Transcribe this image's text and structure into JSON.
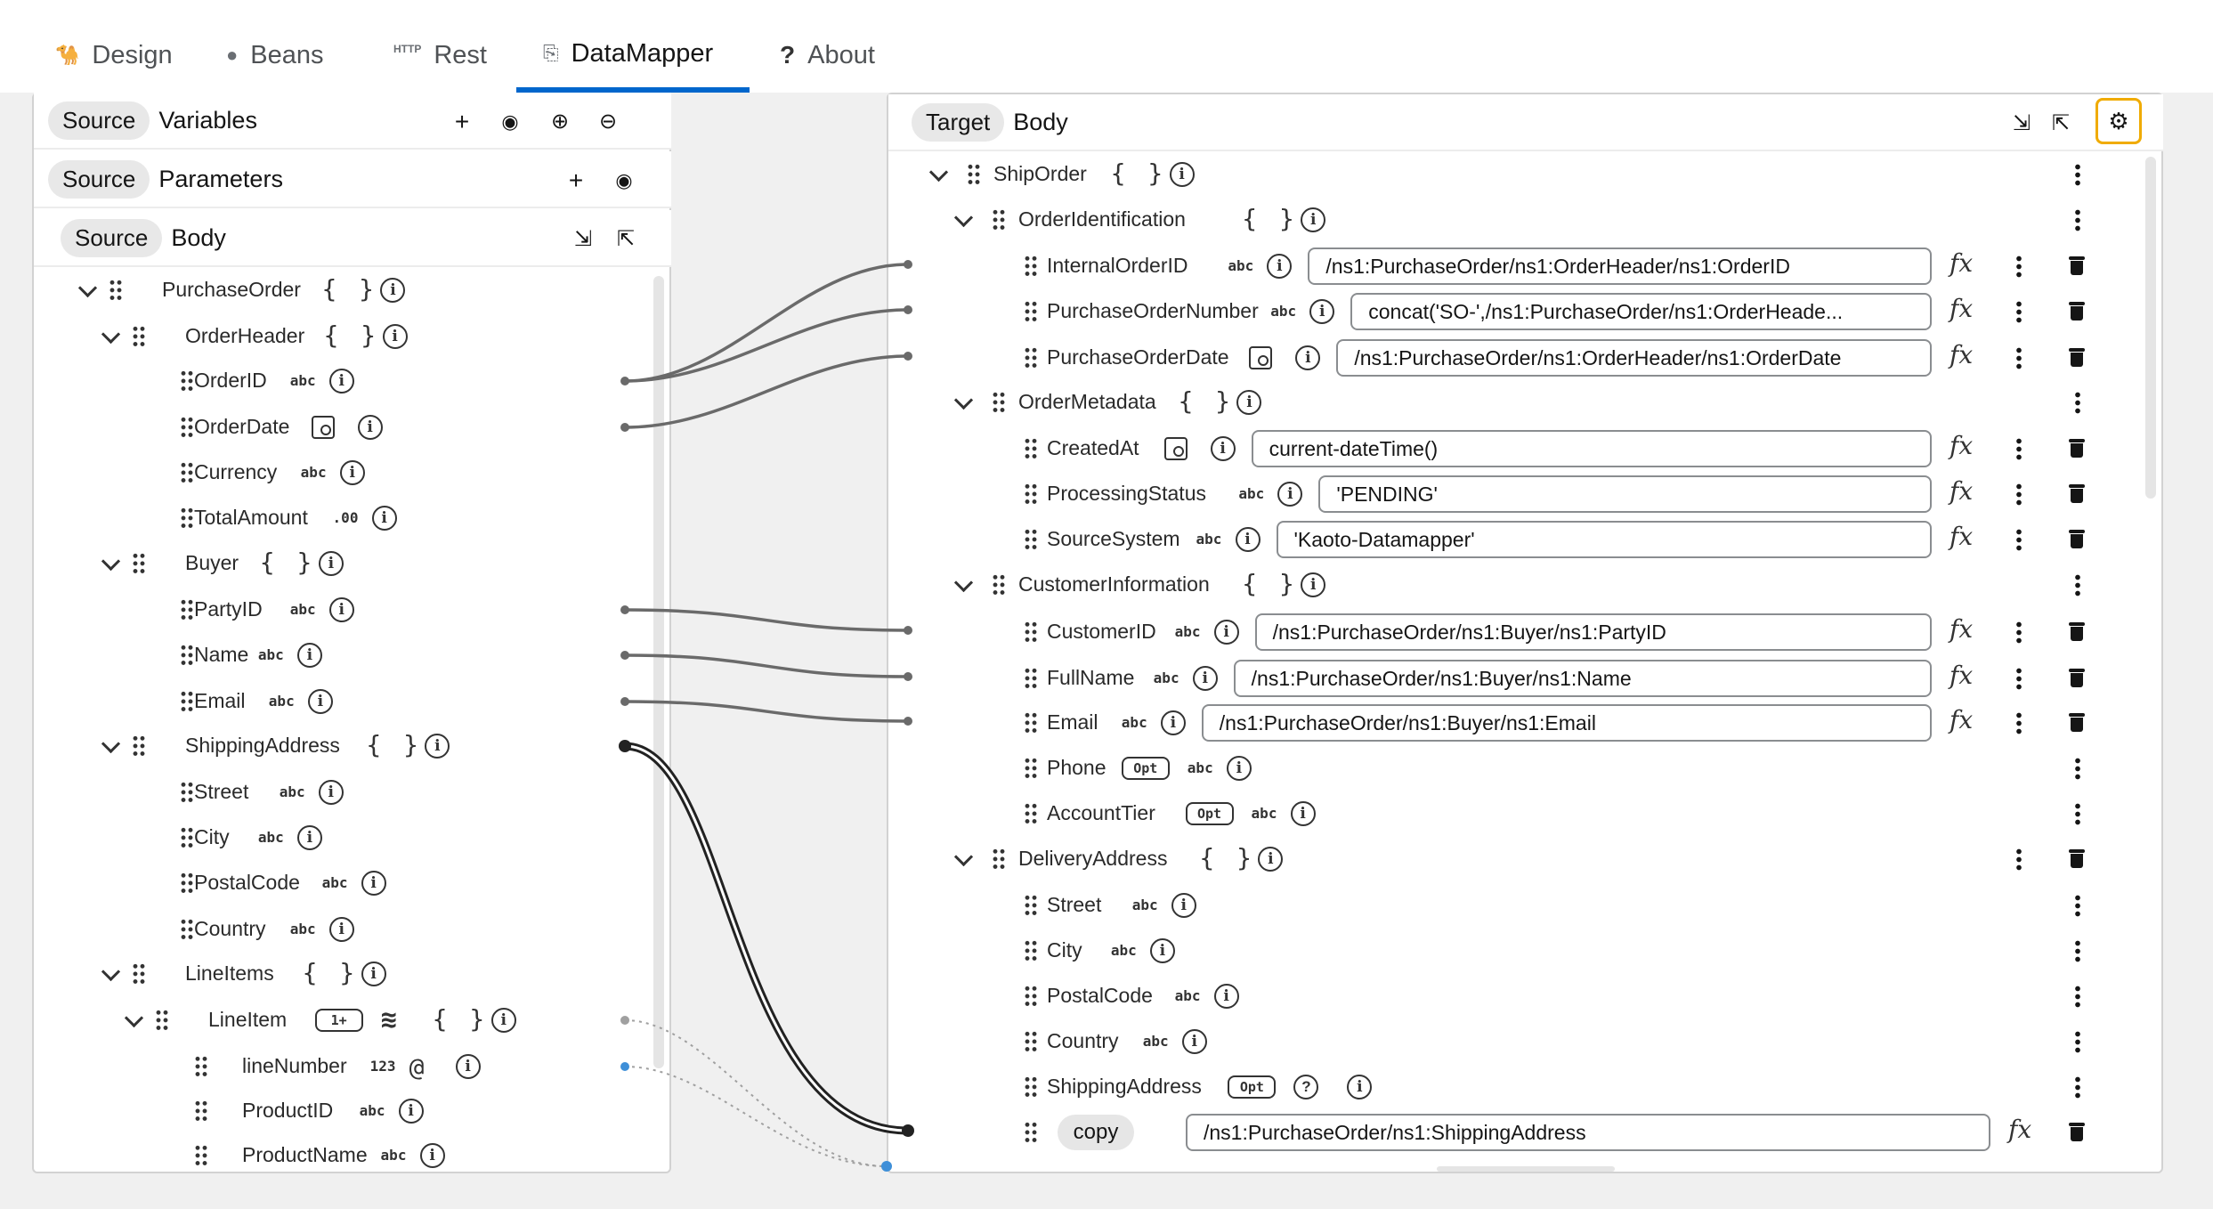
{
  "tabs": [
    {
      "label": "Design",
      "icon": "camel-icon"
    },
    {
      "label": "Beans",
      "icon": "bean-icon"
    },
    {
      "label": "Rest",
      "icon": "http-icon",
      "icon_text": "HTTP"
    },
    {
      "label": "DataMapper",
      "icon": "datamapper-icon"
    },
    {
      "label": "About",
      "icon": "question-icon",
      "icon_text": "?"
    }
  ],
  "source": {
    "pill": "Source",
    "variables": "Variables",
    "parameters": "Parameters",
    "body": "Body",
    "tree": [
      {
        "n": "PurchaseOrder",
        "t": "{ }"
      },
      {
        "n": "OrderHeader",
        "t": "{ }"
      },
      {
        "n": "OrderID",
        "t": "abc"
      },
      {
        "n": "OrderDate",
        "t": "date"
      },
      {
        "n": "Currency",
        "t": "abc"
      },
      {
        "n": "TotalAmount",
        "t": ".00"
      },
      {
        "n": "Buyer",
        "t": "{ }"
      },
      {
        "n": "PartyID",
        "t": "abc"
      },
      {
        "n": "Name",
        "t": "abc"
      },
      {
        "n": "Email",
        "t": "abc"
      },
      {
        "n": "ShippingAddress",
        "t": "{ }"
      },
      {
        "n": "Street",
        "t": "abc"
      },
      {
        "n": "City",
        "t": "abc"
      },
      {
        "n": "PostalCode",
        "t": "abc"
      },
      {
        "n": "Country",
        "t": "abc"
      },
      {
        "n": "LineItems",
        "t": "{ }"
      },
      {
        "n": "LineItem",
        "t": "{ }",
        "badge": "1+"
      },
      {
        "n": "lineNumber",
        "t": "123",
        "at": "@"
      },
      {
        "n": "ProductID",
        "t": "abc"
      },
      {
        "n": "ProductName",
        "t": "abc"
      }
    ]
  },
  "target": {
    "pill": "Target",
    "body": "Body",
    "tree": [
      {
        "n": "ShipOrder",
        "t": "{ }"
      },
      {
        "n": "OrderIdentification",
        "t": "{ }"
      },
      {
        "n": "InternalOrderID",
        "t": "abc",
        "expr": "/ns1:PurchaseOrder/ns1:OrderHeader/ns1:OrderID"
      },
      {
        "n": "PurchaseOrderNumber",
        "t": "abc",
        "expr": "concat('SO-',/ns1:PurchaseOrder/ns1:OrderHeade..."
      },
      {
        "n": "PurchaseOrderDate",
        "t": "date",
        "expr": "/ns1:PurchaseOrder/ns1:OrderHeader/ns1:OrderDate"
      },
      {
        "n": "OrderMetadata",
        "t": "{ }"
      },
      {
        "n": "CreatedAt",
        "t": "date",
        "expr": "current-dateTime()"
      },
      {
        "n": "ProcessingStatus",
        "t": "abc",
        "expr": "'PENDING'"
      },
      {
        "n": "SourceSystem",
        "t": "abc",
        "expr": "'Kaoto-Datamapper'"
      },
      {
        "n": "CustomerInformation",
        "t": "{ }"
      },
      {
        "n": "CustomerID",
        "t": "abc",
        "expr": "/ns1:PurchaseOrder/ns1:Buyer/ns1:PartyID"
      },
      {
        "n": "FullName",
        "t": "abc",
        "expr": "/ns1:PurchaseOrder/ns1:Buyer/ns1:Name"
      },
      {
        "n": "Email",
        "t": "abc",
        "expr": "/ns1:PurchaseOrder/ns1:Buyer/ns1:Email"
      },
      {
        "n": "Phone",
        "t": "abc",
        "badge": "Opt"
      },
      {
        "n": "AccountTier",
        "t": "abc",
        "badge": "Opt"
      },
      {
        "n": "DeliveryAddress",
        "t": "{ }"
      },
      {
        "n": "Street",
        "t": "abc"
      },
      {
        "n": "City",
        "t": "abc"
      },
      {
        "n": "PostalCode",
        "t": "abc"
      },
      {
        "n": "Country",
        "t": "abc"
      },
      {
        "n": "ShippingAddress",
        "badge": "Opt"
      },
      {
        "n": "copy",
        "expr": "/ns1:PurchaseOrder/ns1:ShippingAddress"
      }
    ]
  },
  "fx_label": "fx",
  "colors": {
    "accent": "#0066cc",
    "highlight": "#f0ab00"
  }
}
